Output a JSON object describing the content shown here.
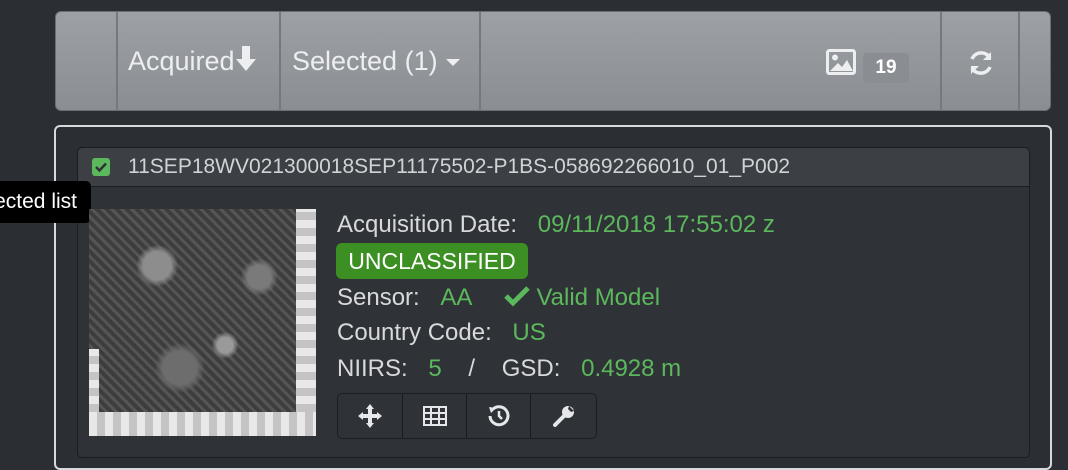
{
  "toolbar": {
    "sort_label": "Acquired",
    "selected_label": "Selected (1)",
    "image_count": "19",
    "icons": {
      "sort": "arrow-down-icon",
      "dropdown": "caret-down-icon",
      "image": "image-icon",
      "refresh": "refresh-icon"
    }
  },
  "tooltip": {
    "text": "Remove from selected list"
  },
  "card": {
    "title": "11SEP18WV021300018SEP11175502-P1BS-058692266010_01_P002",
    "checked": true,
    "acquisition_label": "Acquisition Date:",
    "acquisition_value": "09/11/2018 17:55:02 z",
    "classification": "UNCLASSIFIED",
    "sensor_label": "Sensor:",
    "sensor_value": "AA",
    "model_status": "Valid Model",
    "country_label": "Country Code:",
    "country_value": "US",
    "niirs_label": "NIIRS:",
    "niirs_value": "5",
    "separator": "/",
    "gsd_label": "GSD:",
    "gsd_value": "0.4928 m",
    "action_icons": [
      "move-icon",
      "table-icon",
      "history-icon",
      "wrench-icon"
    ]
  },
  "colors": {
    "accent_green": "#5cb85c",
    "badge_green": "#3c8f22",
    "background": "#2b2e33"
  }
}
